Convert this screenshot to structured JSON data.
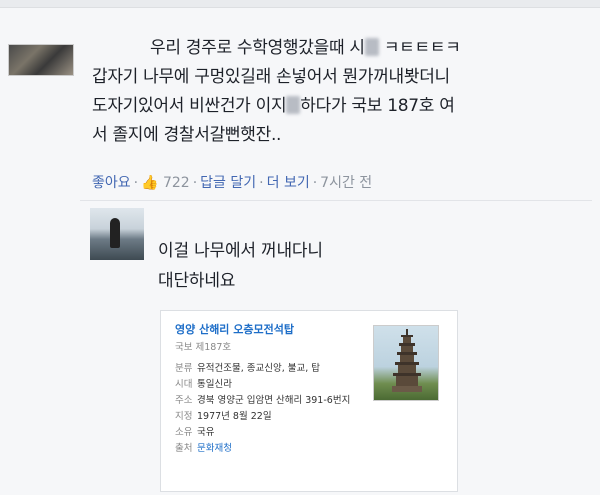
{
  "comment": {
    "line1_a": "우리 경주로 수학영행갔을때 시",
    "line1_b": " ㅋㅌㅌㅌㅋ",
    "line2": "갑자기 나무에 구멍있길래 손넣어서 뭔가꺼내봣더니",
    "line3_a": "도자기있어서 비싼건가 이지",
    "line3_b": "하다가 국보 187호 여",
    "line4": "서 졸지에 경찰서갈뻔햇잔.."
  },
  "meta": {
    "like": "좋아요",
    "like_count": "722",
    "reply": "답글 달기",
    "more": "더 보기",
    "time": "7시간 전"
  },
  "reply": {
    "text": "이걸 나무에서 꺼내다니\n대단하네요"
  },
  "card": {
    "title": "영양 산해리 오층모전석탑",
    "subtitle": "국보 제187호",
    "rows": [
      {
        "k": "분류",
        "v": "유적건조물, 종교신앙, 불교, 탑"
      },
      {
        "k": "시대",
        "v": "통일신라"
      },
      {
        "k": "주소",
        "v": "경북 영양군 입암면 산해리 391-6번지"
      },
      {
        "k": "지정",
        "v": "1977년 8월 22일"
      },
      {
        "k": "소유",
        "v": "국유"
      },
      {
        "k": "출처",
        "v": "문화재청"
      }
    ]
  },
  "colors": {
    "link": "#4267b2",
    "card_link": "#1e6ec8",
    "meta": "#8d949e"
  },
  "icons": {
    "like": "thumbs-up-icon"
  }
}
